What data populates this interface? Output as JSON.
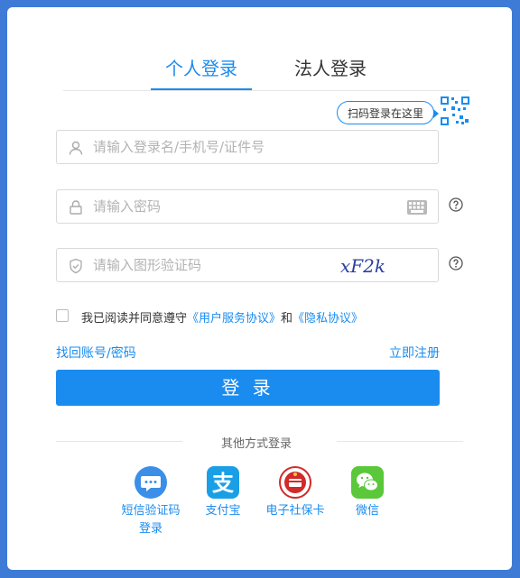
{
  "tabs": {
    "personal": "个人登录",
    "legal": "法人登录"
  },
  "qr_tip": "扫码登录在这里",
  "fields": {
    "username_placeholder": "请输入登录名/手机号/证件号",
    "password_placeholder": "请输入密码",
    "captcha_placeholder": "请输入图形验证码",
    "captcha_text": "xF2k"
  },
  "agreement": {
    "prefix": "我已阅读并同意遵守",
    "user_agreement": "《用户服务协议》",
    "and": "和",
    "privacy": "《隐私协议》"
  },
  "links": {
    "forgot": "找回账号/密码",
    "register": "立即注册"
  },
  "login_button": "登 录",
  "other_methods": {
    "title": "其他方式登录",
    "items": [
      {
        "label": "短信验证码登录",
        "icon": "sms-icon",
        "color": "#3b8fe8"
      },
      {
        "label": "支付宝",
        "icon": "alipay-icon",
        "color": "#1a9fe6"
      },
      {
        "label": "电子社保卡",
        "icon": "social-security-card-icon",
        "color": "#d02a2a"
      },
      {
        "label": "微信",
        "icon": "wechat-icon",
        "color": "#5ac83a"
      }
    ]
  },
  "colors": {
    "background": "#3d7bd6",
    "accent": "#1a8cf0"
  }
}
